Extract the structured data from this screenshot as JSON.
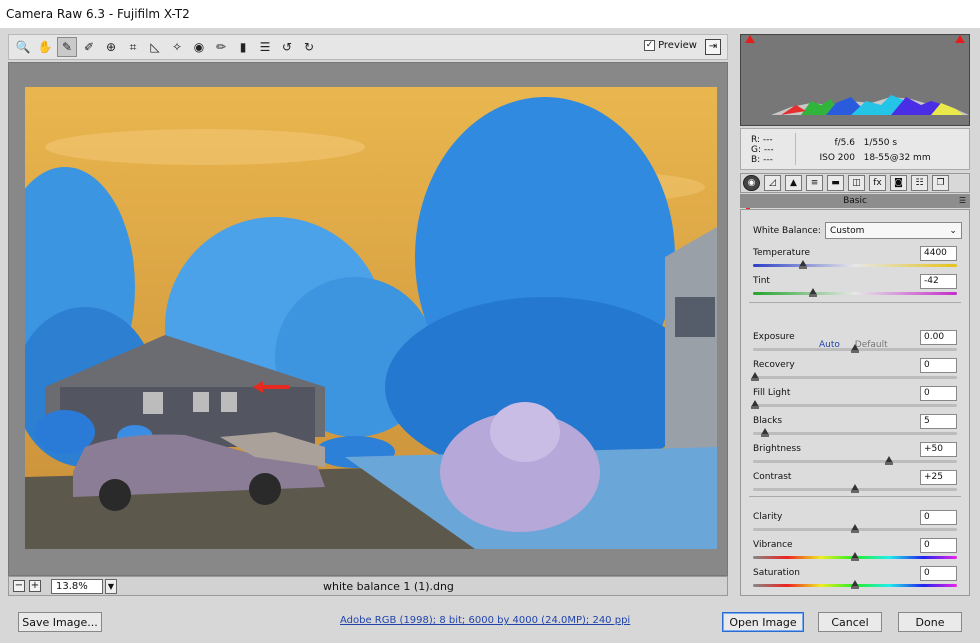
{
  "window": {
    "title": "Camera Raw 6.3  -  Fujifilm X-T2"
  },
  "toolbar": {
    "tools": [
      {
        "name": "zoom-tool-icon",
        "glyph": "🔍"
      },
      {
        "name": "hand-tool-icon",
        "glyph": "✋"
      },
      {
        "name": "white-balance-tool-icon",
        "glyph": "✎",
        "selected": true
      },
      {
        "name": "color-sampler-tool-icon",
        "glyph": "✐"
      },
      {
        "name": "targeted-adjustment-tool-icon",
        "glyph": "⊕"
      },
      {
        "name": "crop-tool-icon",
        "glyph": "⌗"
      },
      {
        "name": "straighten-tool-icon",
        "glyph": "◺"
      },
      {
        "name": "spot-removal-tool-icon",
        "glyph": "✧"
      },
      {
        "name": "red-eye-removal-icon",
        "glyph": "◉"
      },
      {
        "name": "adjustment-brush-icon",
        "glyph": "✏"
      },
      {
        "name": "graduated-filter-icon",
        "glyph": "▮"
      },
      {
        "name": "preferences-icon",
        "glyph": "☰"
      },
      {
        "name": "rotate-left-icon",
        "glyph": "↺"
      },
      {
        "name": "rotate-right-icon",
        "glyph": "↻"
      }
    ],
    "preview_label": "Preview",
    "preview_checked": true
  },
  "preview": {
    "zoom": "13.8%",
    "filename": "white balance 1 (1).dng"
  },
  "info": {
    "r_label": "R:",
    "r_value": "---",
    "g_label": "G:",
    "g_value": "---",
    "b_label": "B:",
    "b_value": "---",
    "aperture": "f/5.6",
    "shutter": "1/550 s",
    "iso": "ISO 200",
    "lens": "18-55@32 mm"
  },
  "panel": {
    "title": "Basic",
    "white_balance_label": "White Balance:",
    "white_balance_value": "Custom",
    "auto_label": "Auto",
    "default_label": "Default",
    "sliders": [
      {
        "key": "temperature",
        "label": "Temperature",
        "value": "4400",
        "pos": 0.24
      },
      {
        "key": "tint",
        "label": "Tint",
        "value": "-42",
        "pos": 0.29
      },
      {
        "key": "exposure",
        "label": "Exposure",
        "value": "0.00",
        "pos": 0.5
      },
      {
        "key": "recovery",
        "label": "Recovery",
        "value": "0",
        "pos": 0.0
      },
      {
        "key": "fill-light",
        "label": "Fill Light",
        "value": "0",
        "pos": 0.0
      },
      {
        "key": "blacks",
        "label": "Blacks",
        "value": "5",
        "pos": 0.05
      },
      {
        "key": "brightness",
        "label": "Brightness",
        "value": "+50",
        "pos": 0.67
      },
      {
        "key": "contrast",
        "label": "Contrast",
        "value": "+25",
        "pos": 0.5
      },
      {
        "key": "clarity",
        "label": "Clarity",
        "value": "0",
        "pos": 0.5
      },
      {
        "key": "vibrance",
        "label": "Vibrance",
        "value": "0",
        "pos": 0.5
      },
      {
        "key": "saturation",
        "label": "Saturation",
        "value": "0",
        "pos": 0.5
      }
    ]
  },
  "footer": {
    "save_label": "Save Image...",
    "workflow_link": "Adobe RGB (1998); 8 bit; 6000 by 4000 (24.0MP); 240 ppi",
    "open_label": "Open Image",
    "cancel_label": "Cancel",
    "done_label": "Done"
  },
  "colors": {
    "accent": "#2a6bd1",
    "annotation_arrow": "#e52b1f"
  }
}
